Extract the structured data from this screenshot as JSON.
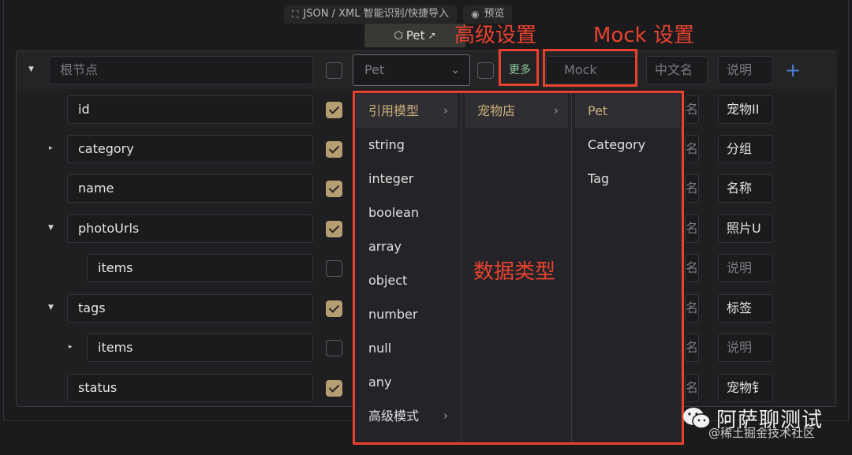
{
  "toolbar": {
    "import_label": "JSON / XML 智能识别/快捷导入",
    "preview_label": "预览",
    "model_tab_label": "Pet"
  },
  "annotations": {
    "advanced": "高级设置",
    "mock": "Mock 设置",
    "types": "数据类型"
  },
  "root_row": {
    "name_placeholder": "根节点",
    "type_value": "Pet",
    "more_label": "更多",
    "mock_placeholder": "Mock",
    "cn_name_placeholder": "中文名",
    "desc_placeholder": "说明"
  },
  "rows": [
    {
      "name": "id",
      "checked": true,
      "desc": "宠物II"
    },
    {
      "name": "category",
      "checked": true,
      "desc": "分组"
    },
    {
      "name": "name",
      "checked": true,
      "desc": "名称"
    },
    {
      "name": "photoUrls",
      "checked": true,
      "desc": "照片U"
    },
    {
      "name": "items",
      "checked": false,
      "desc": "说明"
    },
    {
      "name": "tags",
      "checked": true,
      "desc": "标签"
    },
    {
      "name": "items",
      "checked": false,
      "desc": "说明"
    },
    {
      "name": "status",
      "checked": true,
      "desc": "宠物钅"
    }
  ],
  "cn_fragment": "名",
  "dropdown": {
    "col1": [
      "引用模型",
      "string",
      "integer",
      "boolean",
      "array",
      "object",
      "number",
      "null",
      "any",
      "高级模式"
    ],
    "col2": [
      "宠物店"
    ],
    "col3": [
      "Pet",
      "Category",
      "Tag"
    ]
  },
  "watermark": {
    "title": "阿萨聊测试",
    "sub": "@稀土掘金技术社区"
  },
  "colors": {
    "annotation": "#e8422f",
    "checkbox_on": "#b59e72",
    "more": "#8fcf9b",
    "plus": "#4d7fd6"
  }
}
